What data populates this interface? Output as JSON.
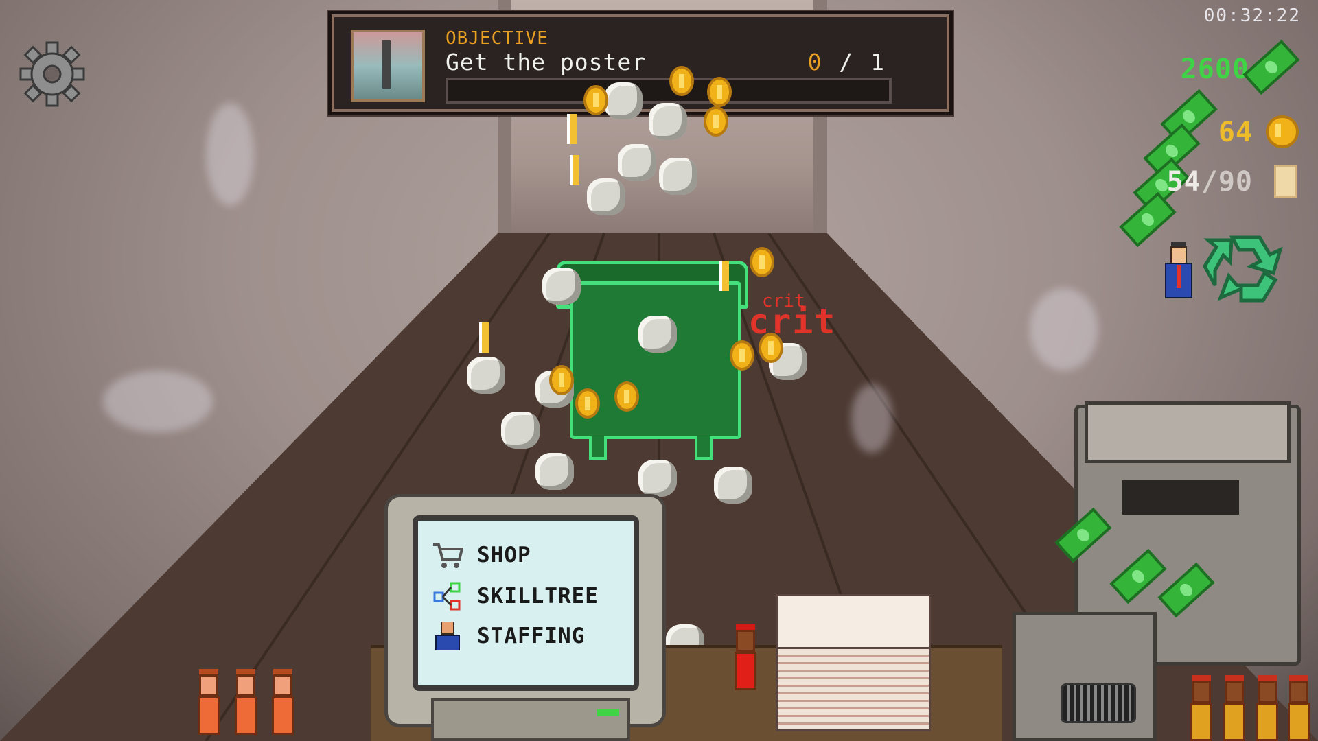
{
  "hud": {
    "timer": "00:32:22",
    "cash": "2600",
    "coins": "64",
    "paper_current": "54",
    "paper_sep": "/",
    "paper_max": "90"
  },
  "objective": {
    "label": "OBJECTIVE",
    "text": "Get the poster",
    "progress_current": "0",
    "progress_sep": " / ",
    "progress_total": "1",
    "progress_fraction": 0
  },
  "effects": {
    "crit_text": "crit",
    "crit_small": "crit"
  },
  "menu": {
    "items": [
      {
        "label": "SHOP",
        "icon": "cart-icon"
      },
      {
        "label": "SKILLTREE",
        "icon": "skilltree-icon"
      },
      {
        "label": "STAFFING",
        "icon": "staff-icon"
      }
    ]
  },
  "colors": {
    "cash": "#3fd445",
    "coins": "#eebc2a",
    "objective_accent": "#e8a020",
    "crit": "#e0342a",
    "dumpster_outline": "#44e07c"
  }
}
